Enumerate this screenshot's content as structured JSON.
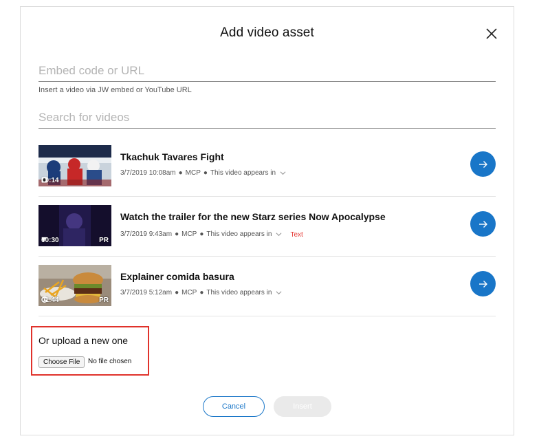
{
  "modal": {
    "title": "Add video asset",
    "close_icon": "close-icon"
  },
  "embed": {
    "placeholder": "Embed code or URL",
    "value": "",
    "help": "Insert a video via JW embed or YouTube URL"
  },
  "search": {
    "placeholder": "Search for videos",
    "value": ""
  },
  "videos": [
    {
      "title": "Tkachuk Tavares Fight",
      "date": "3/7/2019 10:08am",
      "source": "MCP",
      "appears": "This video appears in",
      "tag": "",
      "duration": "00:14",
      "badge": "",
      "provider_icon": "provider-d-icon"
    },
    {
      "title": "Watch the trailer for the new Starz series Now Apocalypse",
      "date": "3/7/2019 9:43am",
      "source": "MCP",
      "appears": "This video appears in",
      "tag": "Text",
      "duration": "00:30",
      "badge": "PR",
      "provider_icon": "provider-t-icon"
    },
    {
      "title": "Explainer comida basura",
      "date": "3/7/2019 5:12am",
      "source": "MCP",
      "appears": "This video appears in",
      "tag": "",
      "duration": "01:44",
      "badge": "PR",
      "provider_icon": "provider-g-icon"
    }
  ],
  "upload": {
    "title": "Or upload a new one",
    "choose_label": "Choose File",
    "no_file": "No file chosen"
  },
  "actions": {
    "cancel": "Cancel",
    "insert": "Insert"
  },
  "colors": {
    "accent": "#1976c8",
    "highlight": "#e0322b",
    "tag": "#e53935"
  }
}
